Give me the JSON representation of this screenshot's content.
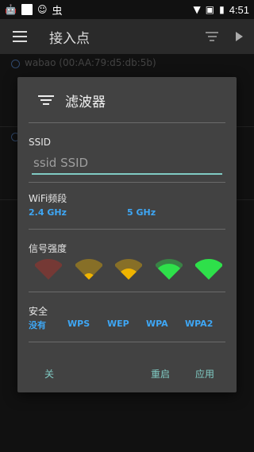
{
  "status_bar": {
    "time": "4:51"
  },
  "toolbar": {
    "title": "接入点"
  },
  "background": {
    "ap_name": "wabao (00:AA:79:d5:db:5b)"
  },
  "dialog": {
    "title": "滤波器",
    "ssid": {
      "label": "SSID",
      "placeholder": "ssid SSID"
    },
    "band": {
      "label": "WiFi频段",
      "options": [
        "2.4 GHz",
        "5 GHz"
      ]
    },
    "signal": {
      "label": "信号强度",
      "levels": [
        {
          "level": 0,
          "color": "#a0332b"
        },
        {
          "level": 1,
          "color": "#f0b400"
        },
        {
          "level": 2,
          "color": "#f0b400"
        },
        {
          "level": 3,
          "color": "#2ee04a"
        },
        {
          "level": 4,
          "color": "#2ee04a"
        }
      ]
    },
    "security": {
      "label": "安全",
      "options": [
        "没有",
        "WPS",
        "WEP",
        "WPA",
        "WPA2"
      ]
    },
    "buttons": {
      "close": "关",
      "reset": "重启",
      "apply": "应用"
    }
  }
}
